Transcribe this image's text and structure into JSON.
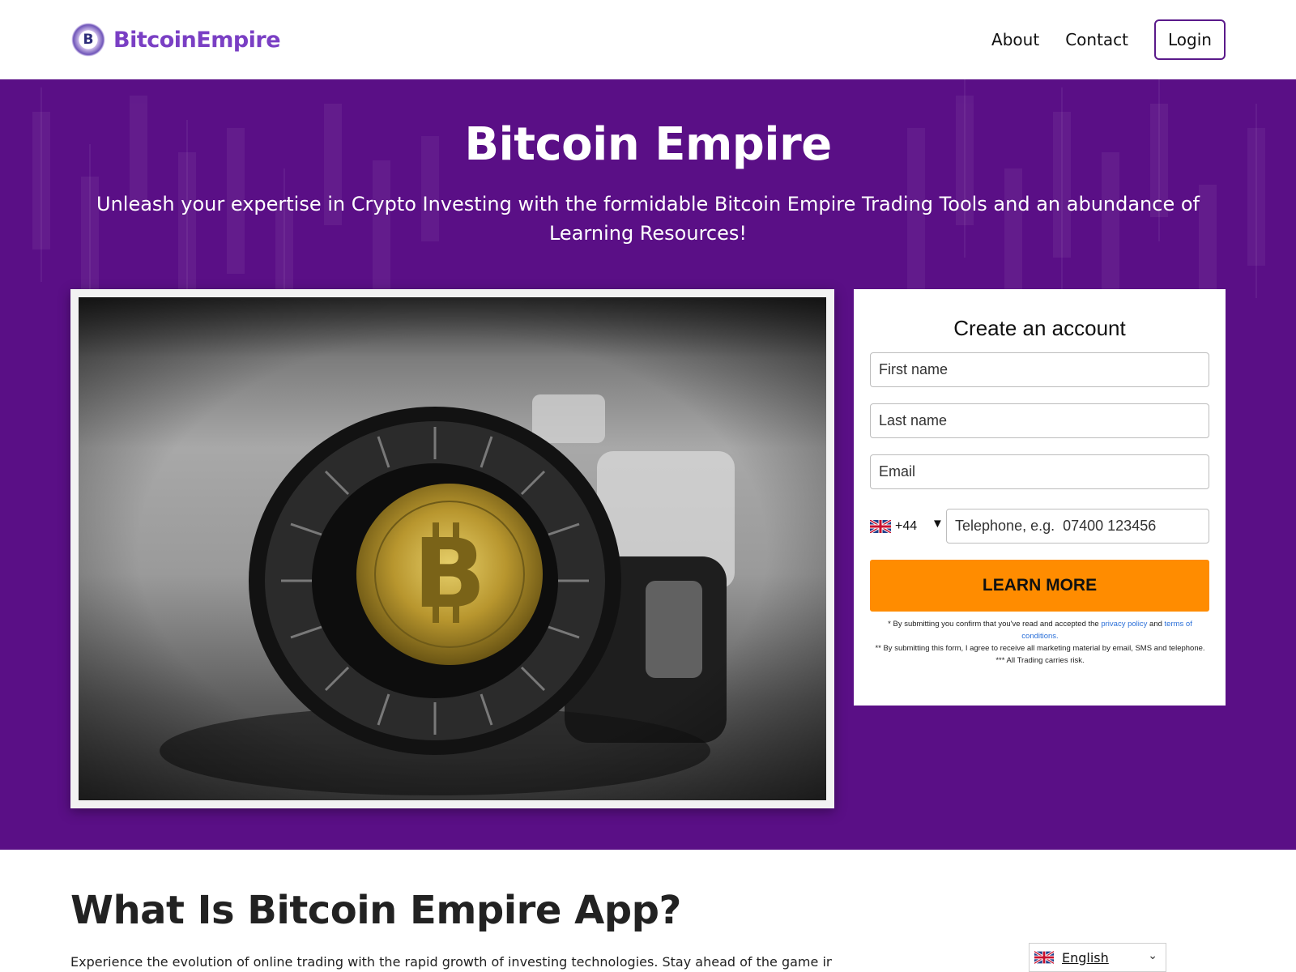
{
  "header": {
    "logo_initial": "B",
    "logo_text": "BitcoinEmpire",
    "nav": {
      "about": "About",
      "contact": "Contact",
      "login": "Login"
    }
  },
  "hero": {
    "title": "Bitcoin Empire",
    "subtitle": "Unleash your expertise in Crypto Investing with the formidable Bitcoin Empire Trading Tools and an abundance of Learning Resources!"
  },
  "signup_form": {
    "title": "Create an account",
    "first_name_placeholder": "First name",
    "last_name_placeholder": "Last name",
    "email_placeholder": "Email",
    "phone_code": "+44",
    "phone_caret": "▼",
    "phone_placeholder": "Telephone, e.g.  07400 123456",
    "submit_label": "LEARN MORE",
    "disclaimer": {
      "line1_prefix": "* By submitting you confirm that you've read and accepted the",
      "privacy_link": "privacy policy",
      "and": "and",
      "terms_link": "terms of conditions.",
      "line2": "** By submitting this form, I agree to receive all marketing material by email, SMS and telephone.",
      "line3": "*** All Trading carries risk."
    }
  },
  "about_section": {
    "title": "What Is Bitcoin Empire App?",
    "intro": "Experience the evolution of online trading with the rapid growth of investing technologies. Stay ahead of the game in"
  },
  "language_selector": {
    "label": "English",
    "caret": "⌄"
  },
  "colors": {
    "brand_purple": "#5a0f86",
    "logo_purple": "#7a3fc4",
    "cta_orange": "#ff8c00",
    "link_blue": "#2a6fd8"
  },
  "icons": {
    "logo": "bitcoin-logo-icon",
    "flag": "uk-flag-icon",
    "dropdown": "chevron-down-icon"
  }
}
